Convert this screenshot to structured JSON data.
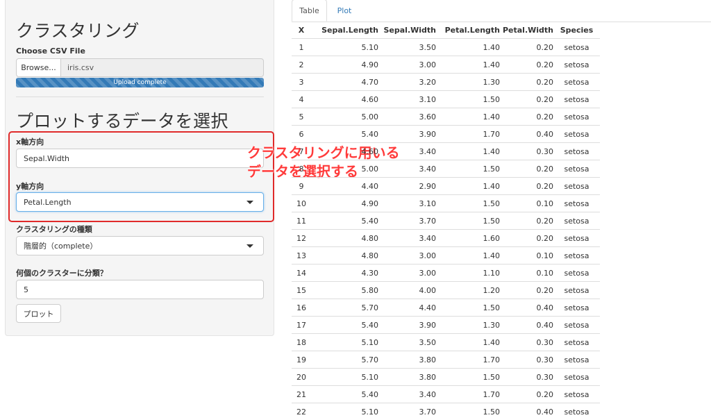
{
  "sidebar": {
    "title": "クラスタリング",
    "file_label": "Choose CSV File",
    "browse_label": "Browse...",
    "file_name": "iris.csv",
    "progress_text": "Upload complete",
    "progress_value": 100,
    "section_title": "プロットするデータを選択",
    "x_label": "x軸方向",
    "x_value": "Sepal.Width",
    "y_label": "y軸方向",
    "y_value": "Petal.Length",
    "method_label": "クラスタリングの種類",
    "method_value": "階層的（complete）",
    "clusters_label": "何個のクラスターに分類？",
    "clusters_value": "5",
    "plot_button": "プロット"
  },
  "annotation": {
    "line1": "クラスタリングに用いる",
    "line2": "データを選択する",
    "color": "#e02a2a"
  },
  "tabs": [
    {
      "label": "Table",
      "active": true
    },
    {
      "label": "Plot",
      "active": false
    }
  ],
  "table": {
    "columns": [
      "X",
      "Sepal.Length",
      "Sepal.Width",
      "Petal.Length",
      "Petal.Width",
      "Species"
    ],
    "rows": [
      [
        "1",
        "5.10",
        "3.50",
        "1.40",
        "0.20",
        "setosa"
      ],
      [
        "2",
        "4.90",
        "3.00",
        "1.40",
        "0.20",
        "setosa"
      ],
      [
        "3",
        "4.70",
        "3.20",
        "1.30",
        "0.20",
        "setosa"
      ],
      [
        "4",
        "4.60",
        "3.10",
        "1.50",
        "0.20",
        "setosa"
      ],
      [
        "5",
        "5.00",
        "3.60",
        "1.40",
        "0.20",
        "setosa"
      ],
      [
        "6",
        "5.40",
        "3.90",
        "1.70",
        "0.40",
        "setosa"
      ],
      [
        "7",
        "4.60",
        "3.40",
        "1.40",
        "0.30",
        "setosa"
      ],
      [
        "8",
        "5.00",
        "3.40",
        "1.50",
        "0.20",
        "setosa"
      ],
      [
        "9",
        "4.40",
        "2.90",
        "1.40",
        "0.20",
        "setosa"
      ],
      [
        "10",
        "4.90",
        "3.10",
        "1.50",
        "0.10",
        "setosa"
      ],
      [
        "11",
        "5.40",
        "3.70",
        "1.50",
        "0.20",
        "setosa"
      ],
      [
        "12",
        "4.80",
        "3.40",
        "1.60",
        "0.20",
        "setosa"
      ],
      [
        "13",
        "4.80",
        "3.00",
        "1.40",
        "0.10",
        "setosa"
      ],
      [
        "14",
        "4.30",
        "3.00",
        "1.10",
        "0.10",
        "setosa"
      ],
      [
        "15",
        "5.80",
        "4.00",
        "1.20",
        "0.20",
        "setosa"
      ],
      [
        "16",
        "5.70",
        "4.40",
        "1.50",
        "0.40",
        "setosa"
      ],
      [
        "17",
        "5.40",
        "3.90",
        "1.30",
        "0.40",
        "setosa"
      ],
      [
        "18",
        "5.10",
        "3.50",
        "1.40",
        "0.30",
        "setosa"
      ],
      [
        "19",
        "5.70",
        "3.80",
        "1.70",
        "0.30",
        "setosa"
      ],
      [
        "20",
        "5.10",
        "3.80",
        "1.50",
        "0.30",
        "setosa"
      ],
      [
        "21",
        "5.40",
        "3.40",
        "1.70",
        "0.20",
        "setosa"
      ],
      [
        "22",
        "5.10",
        "3.70",
        "1.50",
        "0.40",
        "setosa"
      ]
    ]
  }
}
